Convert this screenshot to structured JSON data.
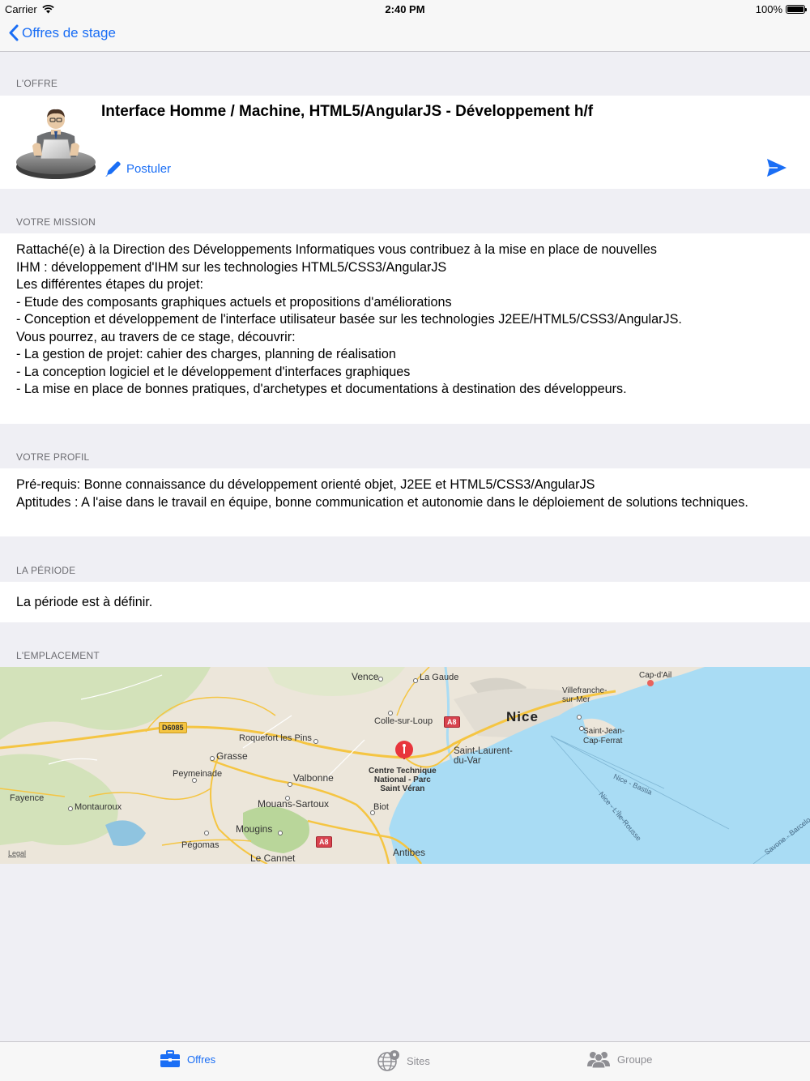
{
  "status_bar": {
    "carrier": "Carrier",
    "time": "2:40 PM",
    "battery": "100%"
  },
  "nav": {
    "back_label": "Offres de stage"
  },
  "offer": {
    "header": "L'OFFRE",
    "title": "Interface Homme / Machine, HTML5/AngularJS - Développement h/f",
    "apply_label": "Postuler"
  },
  "mission": {
    "header": "VOTRE MISSION",
    "text": "Rattaché(e) à la Direction des Développements Informatiques vous contribuez à la mise en place de nouvelles\nIHM : développement d'IHM sur les technologies HTML5/CSS3/AngularJS\nLes différentes étapes du projet:\n- Etude des composants graphiques actuels et propositions d'améliorations\n- Conception et développement de l'interface utilisateur basée sur les technologies J2EE/HTML5/CSS3/AngularJS.\nVous pourrez, au travers de ce stage, découvrir:\n- La gestion de projet: cahier des charges, planning de réalisation\n- La conception logiciel et le développement d'interfaces graphiques\n- La mise en place de bonnes pratiques, d'archetypes et documentations à destination des développeurs."
  },
  "profile": {
    "header": "VOTRE PROFIL",
    "text": "Pré-requis: Bonne connaissance du développement orienté objet, J2EE et HTML5/CSS3/AngularJS\nAptitudes : A l'aise dans le travail en équipe, bonne communication et autonomie dans le déploiement de solutions techniques."
  },
  "period": {
    "header": "LA PÉRIODE",
    "text": "La période est à définir."
  },
  "location": {
    "header": "L'EMPLACEMENT",
    "map": {
      "places": {
        "vence": "Vence",
        "la_gaude": "La Gaude",
        "cap_dail": "Cap-d'Ail",
        "villefranche": "Villefranche-\nsur-Mer",
        "nice": "Nice",
        "colle": "Colle-sur-Loup",
        "saint_jean": "Saint-Jean-\nCap-Ferrat",
        "roquefort": "Roquefort les Pins",
        "grasse": "Grasse",
        "saint_laurent": "Saint-Laurent-\ndu-Var",
        "peymeinade": "Peymeinade",
        "valbonne": "Valbonne",
        "fayence": "Fayence",
        "montauroux": "Montauroux",
        "mouans": "Mouans-Sartoux",
        "biot": "Biot",
        "mougins": "Mougins",
        "pegomas": "Pégomas",
        "le_cannet": "Le Cannet",
        "antibes": "Antibes"
      },
      "pin_label": "Centre Technique\nNational - Parc\nSaint Véran",
      "roads": {
        "d6085": "D6085",
        "a8_1": "A8",
        "a8_2": "A8"
      },
      "sea_routes": {
        "nice_bastia": "Nice - Bastia",
        "nice_ile_rousse": "Nice - L'Île-Rousse",
        "savone": "Savone - Barcelo"
      },
      "legal": "Legal",
      "colors": {
        "sea": "#a9dcf4",
        "land": "#ece6da",
        "road": "#f5c542",
        "pin": "#e8353c"
      }
    }
  },
  "tabs": [
    {
      "label": "Offres",
      "icon": "briefcase-icon",
      "active": true
    },
    {
      "label": "Sites",
      "icon": "globe-icon",
      "active": false
    },
    {
      "label": "Groupe",
      "icon": "group-icon",
      "active": false
    }
  ],
  "colors": {
    "accent": "#1a6ef5",
    "background": "#efeff4",
    "section_text": "#6d6d72"
  }
}
